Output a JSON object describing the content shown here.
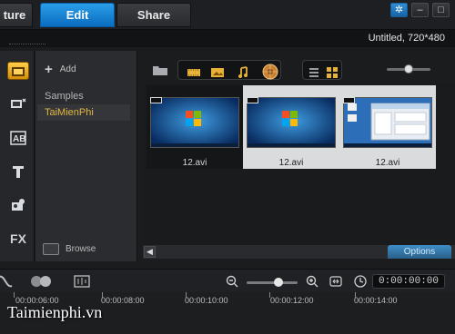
{
  "tabs": [
    {
      "label": "ture"
    },
    {
      "label": "Edit"
    },
    {
      "label": "Share"
    }
  ],
  "project_info": "Untitled, 720*480",
  "library": {
    "add_label": "Add",
    "folders": [
      {
        "label": "Samples"
      },
      {
        "label": "TaiMienPhi"
      }
    ],
    "browse_label": "Browse",
    "zoom_fraction": 0.5,
    "options_label": "Options"
  },
  "thumbnails": [
    {
      "caption": "12.avi"
    },
    {
      "caption": "12.avi"
    },
    {
      "caption": "12.avi"
    }
  ],
  "timeline": {
    "timecode": "0:00:00:00",
    "zoom_fraction": 0.65,
    "ruler_ticks": [
      "00:00:06:00",
      "00:00:08:00",
      "00:00:10:00",
      "00:00:12:00",
      "00:00:14:00"
    ]
  },
  "watermark": "Taimienphi.vn",
  "colors": {
    "active_tab": "#1a86d8",
    "selected_folder_text": "#e3b640",
    "options_button": "#3a7fb4"
  }
}
